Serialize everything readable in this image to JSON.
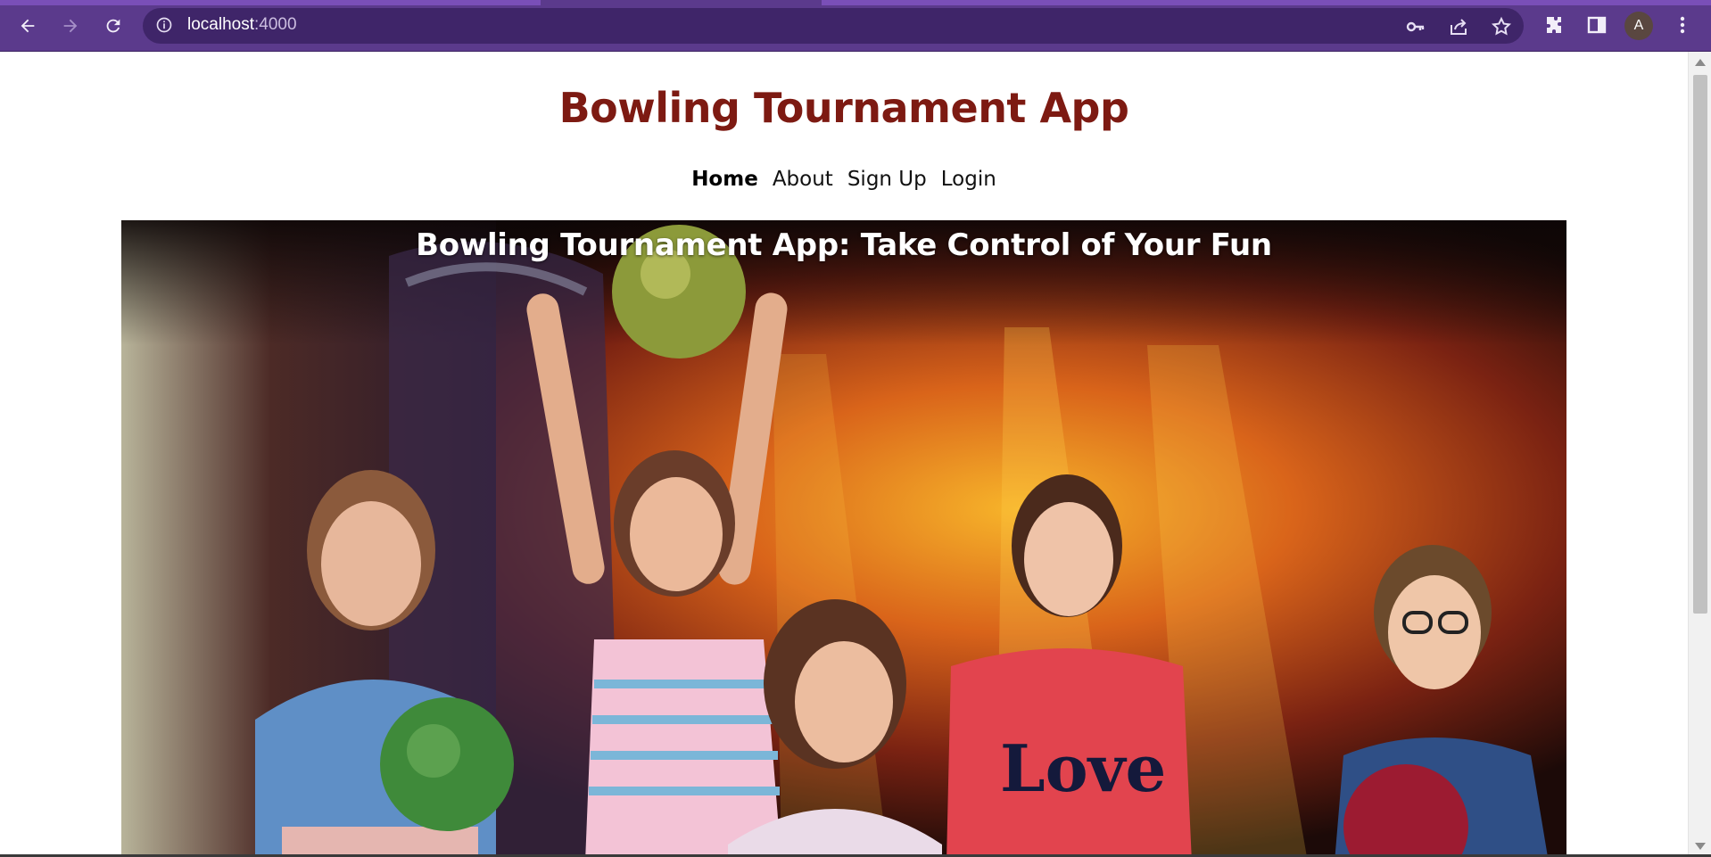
{
  "browser": {
    "url_host": "localhost",
    "url_port": ":4000",
    "profile_initial": "A",
    "icons": {
      "back": "back-arrow-icon",
      "forward": "forward-arrow-icon",
      "reload": "reload-icon",
      "info": "site-info-icon",
      "key": "password-key-icon",
      "share": "share-icon",
      "star": "bookmark-star-icon",
      "extensions": "puzzle-extensions-icon",
      "sidepanel": "side-panel-icon",
      "menu": "kebab-menu-icon"
    },
    "colors": {
      "frame": "#5b3a8c",
      "omnibox": "#3f2569"
    }
  },
  "site": {
    "title": "Bowling Tournament App",
    "title_color": "#7d1a12",
    "nav": [
      {
        "label": "Home",
        "active": true
      },
      {
        "label": "About",
        "active": false
      },
      {
        "label": "Sign Up",
        "active": false
      },
      {
        "label": "Login",
        "active": false
      }
    ],
    "hero": {
      "caption": "Bowling Tournament App: Take Control of Your Fun",
      "image_description_icon": "kids-bowling-photo"
    }
  }
}
